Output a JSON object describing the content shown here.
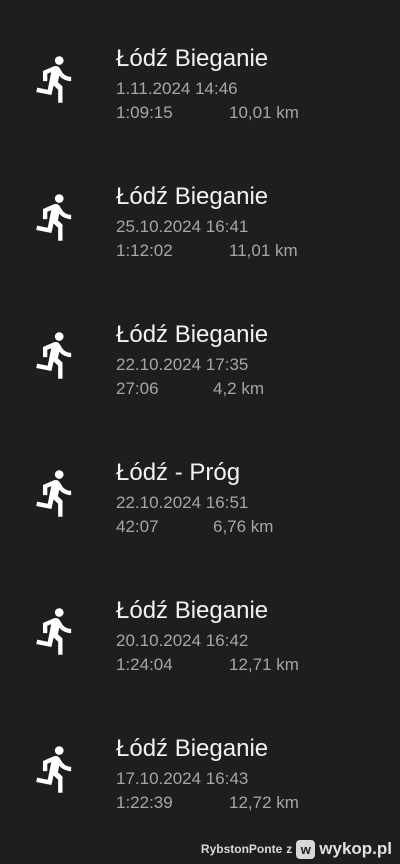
{
  "activities": [
    {
      "title": "Łódź Bieganie",
      "date": "1.11.2024 14:46",
      "duration": "1:09:15",
      "distance": "10,01 km",
      "icon": "running-person-icon"
    },
    {
      "title": "Łódź Bieganie",
      "date": "25.10.2024 16:41",
      "duration": "1:12:02",
      "distance": "11,01 km",
      "icon": "running-person-icon"
    },
    {
      "title": "Łódź Bieganie",
      "date": "22.10.2024 17:35",
      "duration": "27:06",
      "distance": "4,2 km",
      "icon": "running-person-icon"
    },
    {
      "title": "Łódź - Próg",
      "date": "22.10.2024 16:51",
      "duration": "42:07",
      "distance": "6,76 km",
      "icon": "running-person-icon"
    },
    {
      "title": "Łódź Bieganie",
      "date": "20.10.2024 16:42",
      "duration": "1:24:04",
      "distance": "12,71 km",
      "icon": "running-person-icon"
    },
    {
      "title": "Łódź Bieganie",
      "date": "17.10.2024 16:43",
      "duration": "1:22:39",
      "distance": "12,72 km",
      "icon": "running-person-icon"
    }
  ],
  "footer": {
    "user": "RybstonPonte",
    "separator": "z",
    "logo_letter": "w",
    "brand": "wykop.pl"
  },
  "colors": {
    "background": "#1e1e1e",
    "title": "#f2f2f2",
    "secondary": "#a6a6a6",
    "icon": "#ffffff"
  }
}
